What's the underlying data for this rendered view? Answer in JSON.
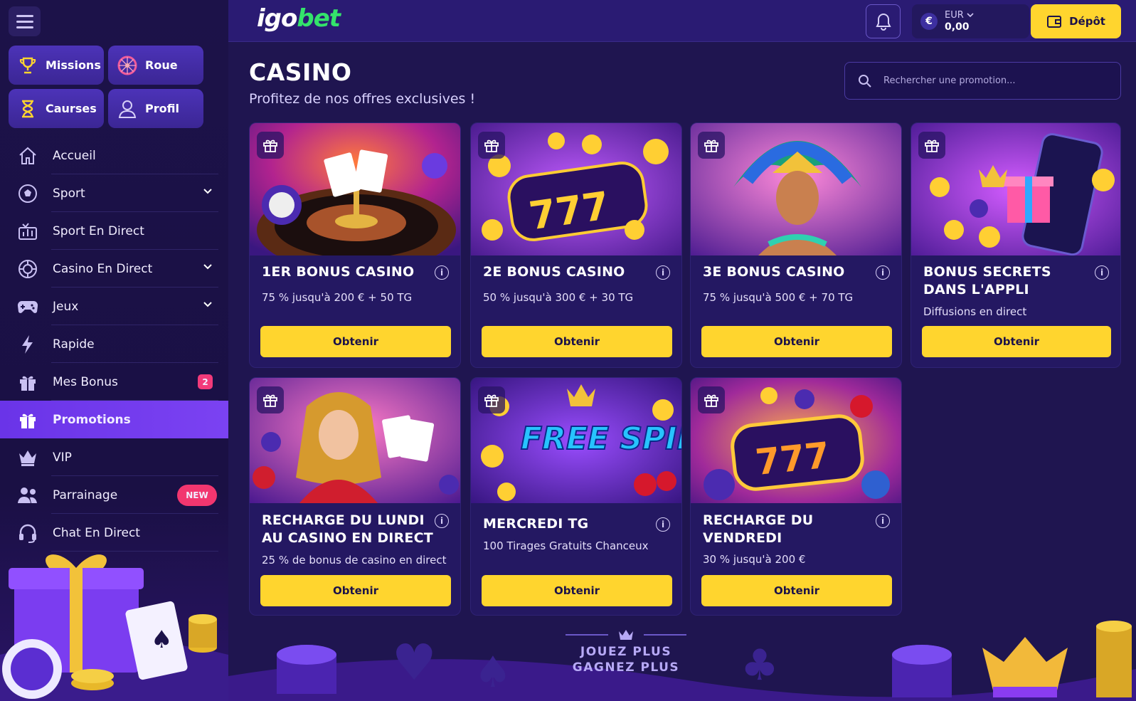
{
  "brand": {
    "logo_part1": "igo",
    "logo_part2": "bet"
  },
  "topbar": {
    "currency": "EUR",
    "balance": "0,00",
    "currency_symbol": "€",
    "deposit_label": "Dépôt"
  },
  "quick_links": [
    {
      "label": "Missions",
      "icon": "trophy-icon"
    },
    {
      "label": "Roue",
      "icon": "wheel-icon"
    },
    {
      "label": "Caurses",
      "icon": "hourglass-icon"
    },
    {
      "label": "Profil",
      "icon": "user-icon"
    }
  ],
  "nav": [
    {
      "label": "Accueil",
      "icon": "home-icon"
    },
    {
      "label": "Sport",
      "icon": "soccer-ball-icon",
      "expandable": true
    },
    {
      "label": "Sport En Direct",
      "icon": "stats-icon"
    },
    {
      "label": "Casino En Direct",
      "icon": "chip-icon",
      "expandable": true
    },
    {
      "label": "Jeux",
      "icon": "gamepad-icon",
      "expandable": true
    },
    {
      "label": "Rapide",
      "icon": "lightning-icon"
    },
    {
      "label": "Mes Bonus",
      "icon": "gift-icon",
      "badge": "2"
    },
    {
      "label": "Promotions",
      "icon": "gift-icon",
      "active": true
    },
    {
      "label": "VIP",
      "icon": "crown-icon"
    },
    {
      "label": "Parrainage",
      "icon": "users-icon",
      "badge": "NEW"
    },
    {
      "label": "Chat En Direct",
      "icon": "headset-icon"
    }
  ],
  "page": {
    "title": "CASINO",
    "subtitle": "Profitez de nos offres exclusives !",
    "search_placeholder": "Rechercher une promotion..."
  },
  "promotions": [
    {
      "title": "1ER BONUS CASINO",
      "desc": "75 % jusqu'à 200 € + 50 TG",
      "button": "Obtenir"
    },
    {
      "title": "2E BONUS CASINO",
      "desc": "50 % jusqu'à 300 € + 30 TG",
      "button": "Obtenir"
    },
    {
      "title": "3E BONUS CASINO",
      "desc": "75 % jusqu'à 500 € + 70 TG",
      "button": "Obtenir"
    },
    {
      "title": "BONUS SECRETS DANS L'APPLI",
      "desc": "Diffusions en direct",
      "button": "Obtenir"
    },
    {
      "title": "RECHARGE DU LUNDI AU CASINO EN DIRECT",
      "desc": "25 % de bonus de casino en direct",
      "button": "Obtenir"
    },
    {
      "title": "MERCREDI TG",
      "desc": "100 Tirages Gratuits Chanceux",
      "button": "Obtenir",
      "image_text": "FREE SPINS"
    },
    {
      "title": "RECHARGE DU VENDREDI",
      "desc": "30 % jusqu'à 200 €",
      "button": "Obtenir"
    }
  ],
  "footer": {
    "line1": "JOUEZ PLUS",
    "line2": "GAGNEZ PLUS"
  },
  "colors": {
    "accent": "#ffd52e",
    "active_nav": "#6a34e8",
    "brand_green": "#34e36b",
    "badge": "#f23a7a"
  }
}
